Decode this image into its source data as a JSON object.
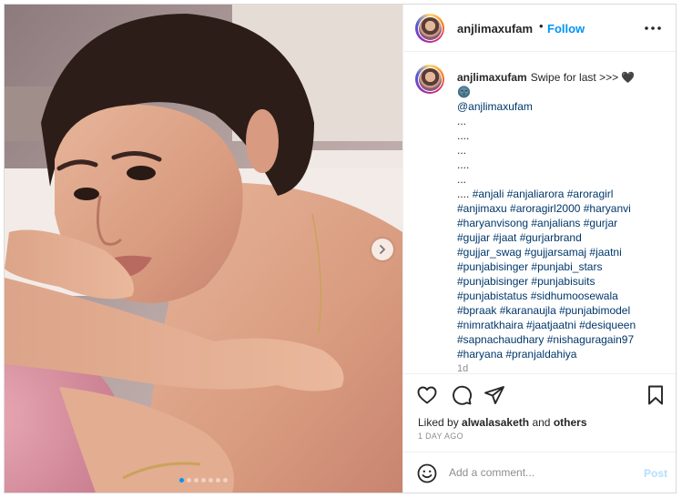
{
  "post": {
    "username": "anjlimaxufam",
    "separator": "•",
    "follow_label": "Follow",
    "more_icon": "more-horizontal-icon",
    "carousel": {
      "slide_count": 7,
      "active_index": 0,
      "next_icon": "chevron-right-icon"
    }
  },
  "caption": {
    "author": "anjlimaxufam",
    "first_line": "Swipe for last >>> 🖤",
    "emoji_line": "🌚",
    "mention": "@anjlimaxufam",
    "dots": [
      "...",
      "....",
      "...",
      "....",
      "..."
    ],
    "lines": [
      "#anjali #anjaliarora #aroragirl",
      "#anjimaxu #aroragirl2000 #haryanvi",
      "#haryanvisong #anjalians #gurjar",
      "#gujjar #jaat #gurjarbrand",
      "#gujjar_swag #gujjarsamaj #jaatni",
      "#punjabisinger #punjabi_stars",
      "#punjabisinger #punjabisuits",
      "#punjabistatus #sidhumoosewala",
      "#bpraak #karanaujla #punjabimodel",
      "#nimratkhaira #jaatjaatni #desiqueen",
      "#sapnachaudhary #nishaguragain97",
      "#haryana #pranjaldahiya"
    ],
    "first_line_prefix": "....",
    "time": "1d"
  },
  "actions": {
    "icons": [
      "heart-icon",
      "comment-icon",
      "share-icon",
      "bookmark-icon"
    ],
    "liked_by_prefix": "Liked by",
    "liked_by_user": "alwalasaketh",
    "liked_by_and": "and",
    "liked_by_others": "others",
    "age": "1 DAY AGO"
  },
  "comment_box": {
    "placeholder": "Add a comment...",
    "post_label": "Post",
    "emoji_icon": "smiley-icon"
  },
  "colors": {
    "accent": "#0095f6",
    "post_disabled": "#b2dffc",
    "link": "#00376b",
    "muted": "#8e8e8e"
  }
}
